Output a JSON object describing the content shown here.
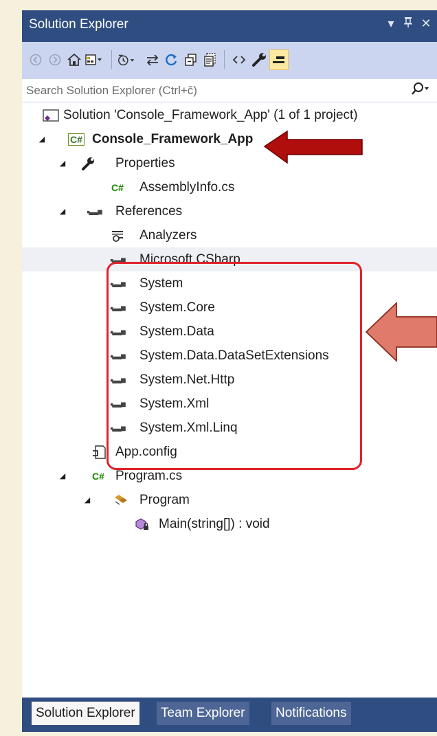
{
  "window": {
    "title": "Solution Explorer",
    "title_buttons": [
      "▾",
      "⊥",
      "✕"
    ]
  },
  "toolbar": {
    "buttons": [
      {
        "name": "back",
        "glyph": "◀"
      },
      {
        "name": "forward",
        "glyph": "▶"
      },
      {
        "name": "home",
        "glyph": "⌂"
      },
      {
        "name": "switch-views",
        "glyph": "⊞"
      },
      {
        "name": "pending-changes-filter",
        "glyph": "◷"
      },
      {
        "name": "sync-with-active-document",
        "glyph": "⇆"
      },
      {
        "name": "refresh",
        "glyph": "↻"
      },
      {
        "name": "collapse-all",
        "glyph": "⧉"
      },
      {
        "name": "show-all-files",
        "glyph": "⧇"
      },
      {
        "name": "view-code",
        "glyph": "‹›"
      },
      {
        "name": "properties",
        "glyph": "🔧"
      },
      {
        "name": "preview-selected-items",
        "glyph": "▬"
      }
    ]
  },
  "search": {
    "placeholder": "Search Solution Explorer (Ctrl+č)",
    "icon": "search-icon"
  },
  "tree": {
    "solution": "Solution 'Console_Framework_App' (1 of 1 project)",
    "project": "Console_Framework_App",
    "project_icon_text": "C#",
    "properties": "Properties",
    "assembly_info": "AssemblyInfo.cs",
    "references": "References",
    "analyzers": "Analyzers",
    "reference_items": [
      "Microsoft.CSharp",
      "System",
      "System.Core",
      "System.Data",
      "System.Data.DataSetExtensions",
      "System.Net.Http",
      "System.Xml",
      "System.Xml.Linq"
    ],
    "app_config": "App.config",
    "program_cs": "Program.cs",
    "program_class": "Program",
    "main_method": "Main(string[]) : void",
    "cs_glyph": "C#"
  },
  "tabs": {
    "items": [
      "Solution Explorer",
      "Team Explorer",
      "Notifications"
    ],
    "active": "Solution Explorer"
  },
  "colors": {
    "window_frame": "#2f4d80",
    "toolbar_bg": "#ccd5f0",
    "highlight_box": "#e0222a",
    "arrow_dark_red": "#b00d0d",
    "arrow_salmon": "#e07a6a",
    "page_bg": "#f6f1dc"
  }
}
